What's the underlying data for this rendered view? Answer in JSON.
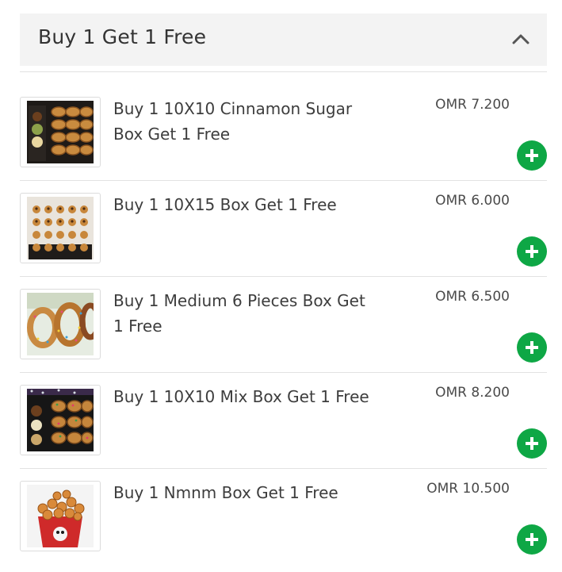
{
  "section": {
    "title": "Buy 1 Get 1 Free",
    "collapse_icon": "chevron-up-icon"
  },
  "colors": {
    "add_button": "#0ea745",
    "header_bg": "#f3f3f3",
    "divider": "#e2e2e2"
  },
  "items": [
    {
      "name": "Buy 1 10X10 Cinnamon Sugar Box Get 1 Free",
      "price": "OMR 7.200",
      "image": "cinnamon-sugar-box-photo"
    },
    {
      "name": "Buy 1 10X15 Box Get 1 Free",
      "price": "OMR 6.000",
      "image": "10x15-box-photo"
    },
    {
      "name": "Buy 1 Medium 6 Pieces Box Get 1 Free",
      "price": "OMR 6.500",
      "image": "medium-6-pieces-box-photo"
    },
    {
      "name": "Buy 1 10X10 Mix Box Get 1 Free",
      "price": "OMR 8.200",
      "image": "mix-box-photo"
    },
    {
      "name": "Buy 1 Nmnm Box Get 1 Free",
      "price": "OMR 10.500",
      "image": "nmnm-box-photo"
    }
  ]
}
